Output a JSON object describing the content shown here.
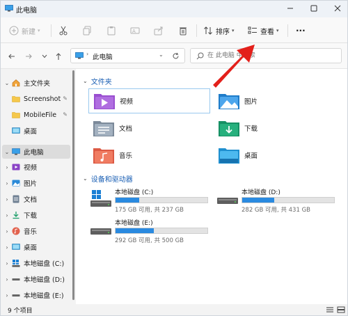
{
  "titlebar": {
    "title": "此电脑"
  },
  "toolbar": {
    "new_label": "新建",
    "sort_label": "排序",
    "view_label": "查看",
    "more_label": "···"
  },
  "address": {
    "path": "此电脑"
  },
  "search": {
    "placeholder": "在 此电脑 中搜索"
  },
  "sidebar": {
    "items": [
      {
        "label": "主文件夹",
        "icon": "home-icon"
      },
      {
        "label": "Screenshot",
        "icon": "folder-icon",
        "pinned": true
      },
      {
        "label": "MobileFile",
        "icon": "folder-icon",
        "pinned": true
      },
      {
        "label": "桌面",
        "icon": "desktop-icon"
      },
      {
        "label": "此电脑",
        "icon": "pc-icon",
        "selected": true
      },
      {
        "label": "视频",
        "icon": "video-icon"
      },
      {
        "label": "图片",
        "icon": "pictures-icon"
      },
      {
        "label": "文档",
        "icon": "documents-icon"
      },
      {
        "label": "下载",
        "icon": "downloads-icon"
      },
      {
        "label": "音乐",
        "icon": "music-icon"
      },
      {
        "label": "桌面",
        "icon": "desktop-icon"
      },
      {
        "label": "本地磁盘 (C:)",
        "icon": "drive-icon"
      },
      {
        "label": "本地磁盘 (D:)",
        "icon": "drive-icon"
      },
      {
        "label": "本地磁盘 (E:)",
        "icon": "drive-icon"
      }
    ]
  },
  "content": {
    "folders_header": "文件夹",
    "folders": [
      {
        "name": "视频",
        "icon": "video-folder-icon"
      },
      {
        "name": "图片",
        "icon": "pictures-folder-icon"
      },
      {
        "name": "文档",
        "icon": "documents-folder-icon"
      },
      {
        "name": "下载",
        "icon": "downloads-folder-icon"
      },
      {
        "name": "音乐",
        "icon": "music-folder-icon"
      },
      {
        "name": "桌面",
        "icon": "desktop-folder-icon"
      }
    ],
    "drives_header": "设备和驱动器",
    "drives": [
      {
        "name": "本地磁盘 (C:)",
        "info": "175 GB 可用, 共 237 GB",
        "used_fraction": 0.26
      },
      {
        "name": "本地磁盘 (D:)",
        "info": "282 GB 可用, 共 431 GB",
        "used_fraction": 0.35
      },
      {
        "name": "本地磁盘 (E:)",
        "info": "292 GB 可用, 共 500 GB",
        "used_fraction": 0.42
      }
    ]
  },
  "status": {
    "item_count": "9 个项目"
  },
  "colors": {
    "accent": "#1a5fb4",
    "drive_bar": "#2a8ae0",
    "annotation_arrow": "#e3201b"
  }
}
